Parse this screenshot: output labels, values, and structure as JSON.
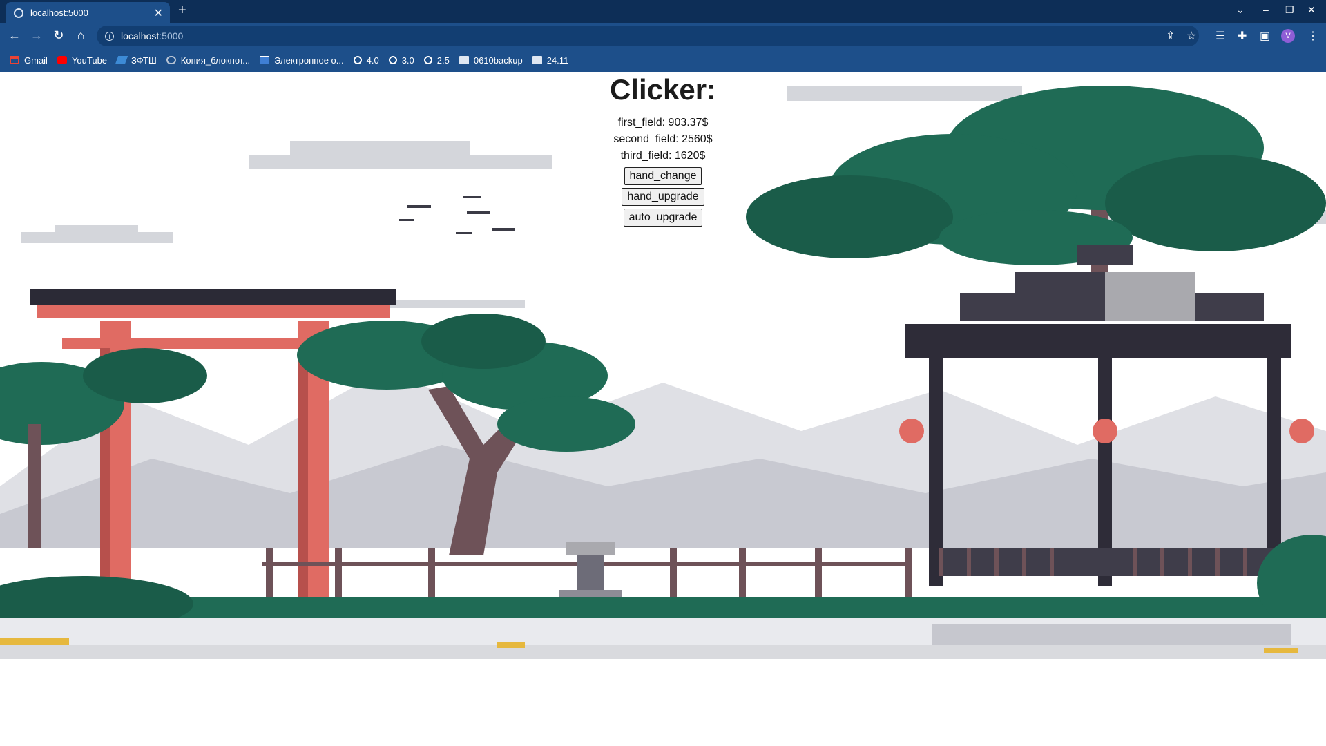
{
  "browser": {
    "tab_title": "localhost:5000",
    "url_host": "localhost",
    "url_port": ":5000",
    "bookmarks": [
      "Gmail",
      "YouTube",
      "ЗФТШ",
      "Копия_блокнот...",
      "Электронное о...",
      "4.0",
      "3.0",
      "2.5",
      "0610backup",
      "24.11"
    ],
    "avatar_letter": "V"
  },
  "page": {
    "title": "Clicker:",
    "fields": [
      {
        "label": "first_field: 903.37$"
      },
      {
        "label": "second_field: 2560$"
      },
      {
        "label": "third_field: 1620$"
      }
    ],
    "buttons": {
      "hand_change": "hand_change",
      "hand_upgrade": "hand_upgrade",
      "auto_upgrade": "auto_upgrade"
    }
  },
  "colors": {
    "chrome_dark": "#0d2e57",
    "chrome": "#1d4f8a",
    "torii": "#e06b63",
    "foliage": "#1f6b55",
    "trunk": "#6e5258",
    "roof": "#3f3d4a"
  }
}
